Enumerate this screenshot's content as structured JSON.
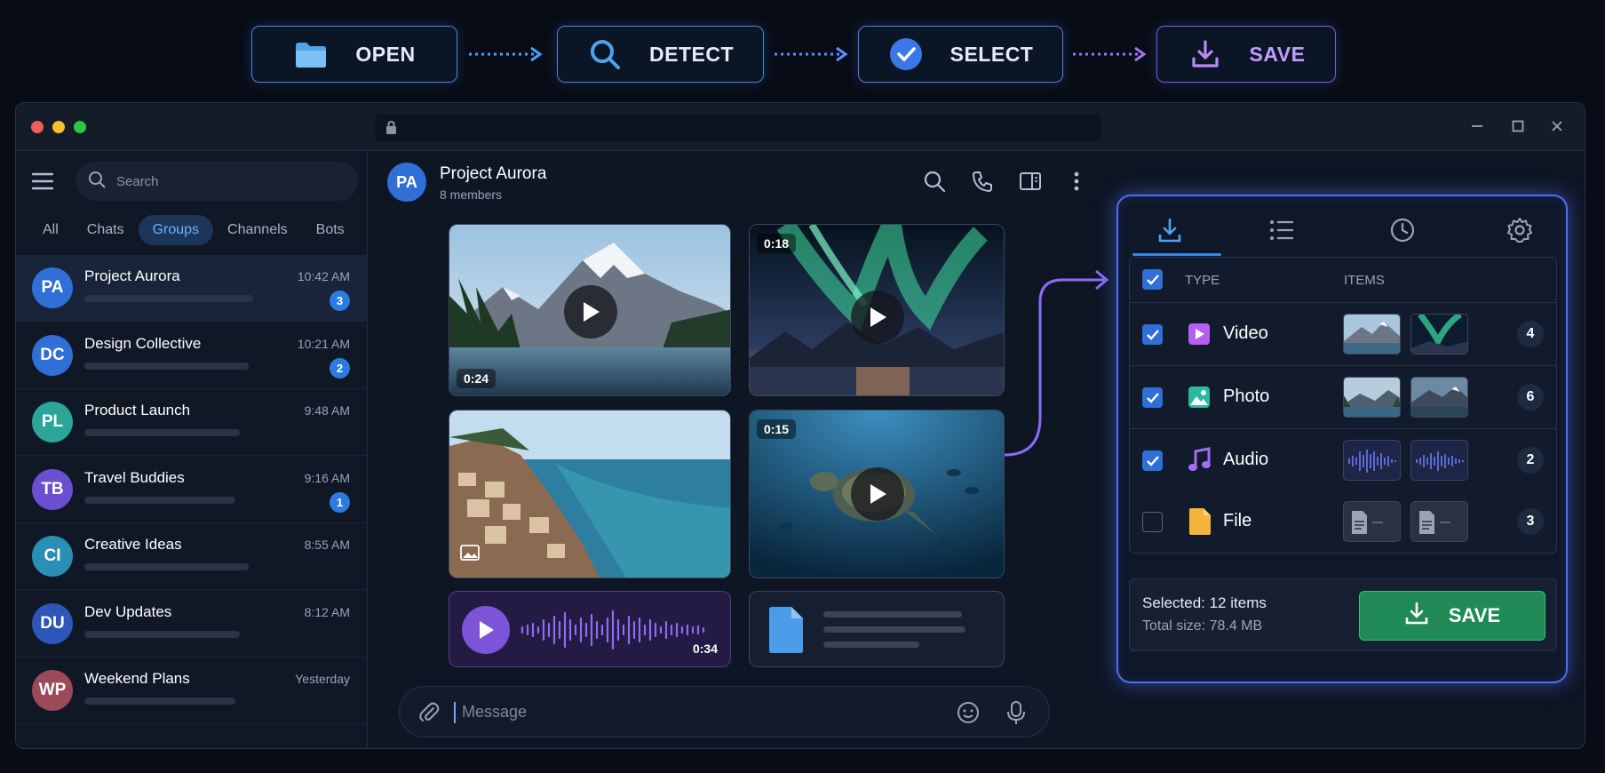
{
  "workflow": {
    "steps": [
      {
        "label": "OPEN",
        "icon": "folder-icon"
      },
      {
        "label": "DETECT",
        "icon": "magnifier-icon"
      },
      {
        "label": "SELECT",
        "icon": "check-circle-icon"
      },
      {
        "label": "SAVE",
        "icon": "download-icon"
      }
    ]
  },
  "sidebar": {
    "search_placeholder": "Search",
    "filters": [
      "All",
      "Chats",
      "Groups",
      "Channels",
      "Bots"
    ],
    "active_filter": "Groups",
    "chats": [
      {
        "initials": "PA",
        "name": "Project Aurora",
        "time": "10:42 AM",
        "unread": "3",
        "color": "#2f6fd6",
        "active": true
      },
      {
        "initials": "DC",
        "name": "Design Collective",
        "time": "10:21 AM",
        "unread": "2",
        "color": "#2f6fd6"
      },
      {
        "initials": "PL",
        "name": "Product Launch",
        "time": "9:48 AM",
        "unread": "",
        "color": "#2aa597"
      },
      {
        "initials": "TB",
        "name": "Travel Buddies",
        "time": "9:16 AM",
        "unread": "1",
        "color": "#6a4fd0"
      },
      {
        "initials": "CI",
        "name": "Creative Ideas",
        "time": "8:55 AM",
        "unread": "",
        "color": "#2a8fb5"
      },
      {
        "initials": "DU",
        "name": "Dev Updates",
        "time": "8:12 AM",
        "unread": "",
        "color": "#2d56b8"
      },
      {
        "initials": "WP",
        "name": "Weekend Plans",
        "time": "Yesterday",
        "unread": "",
        "color": "#9a4a58"
      }
    ]
  },
  "chat": {
    "avatar": "PA",
    "title": "Project Aurora",
    "subtitle": "8 members",
    "media": {
      "video1_duration": "0:24",
      "video2_duration": "0:18",
      "video3_duration": "0:15",
      "audio_duration": "0:34"
    },
    "message_placeholder": "Message"
  },
  "panel": {
    "tabs": [
      "download-icon",
      "list-icon",
      "clock-icon",
      "gear-icon"
    ],
    "header": {
      "type": "TYPE",
      "items": "ITEMS"
    },
    "rows": [
      {
        "label": "Video",
        "count": "4",
        "checked": true,
        "icon": "video-icon"
      },
      {
        "label": "Photo",
        "count": "6",
        "checked": true,
        "icon": "photo-icon"
      },
      {
        "label": "Audio",
        "count": "2",
        "checked": true,
        "icon": "music-note-icon"
      },
      {
        "label": "File",
        "count": "3",
        "checked": false,
        "icon": "file-icon"
      }
    ],
    "selected_text": "Selected: 12 items",
    "total_size_text": "Total size: 78.4 MB",
    "save_label": "SAVE"
  },
  "colors": {
    "accent": "#2f6fd6",
    "save_green": "#1f8a55",
    "panel_glow": "#4a6ff0"
  }
}
